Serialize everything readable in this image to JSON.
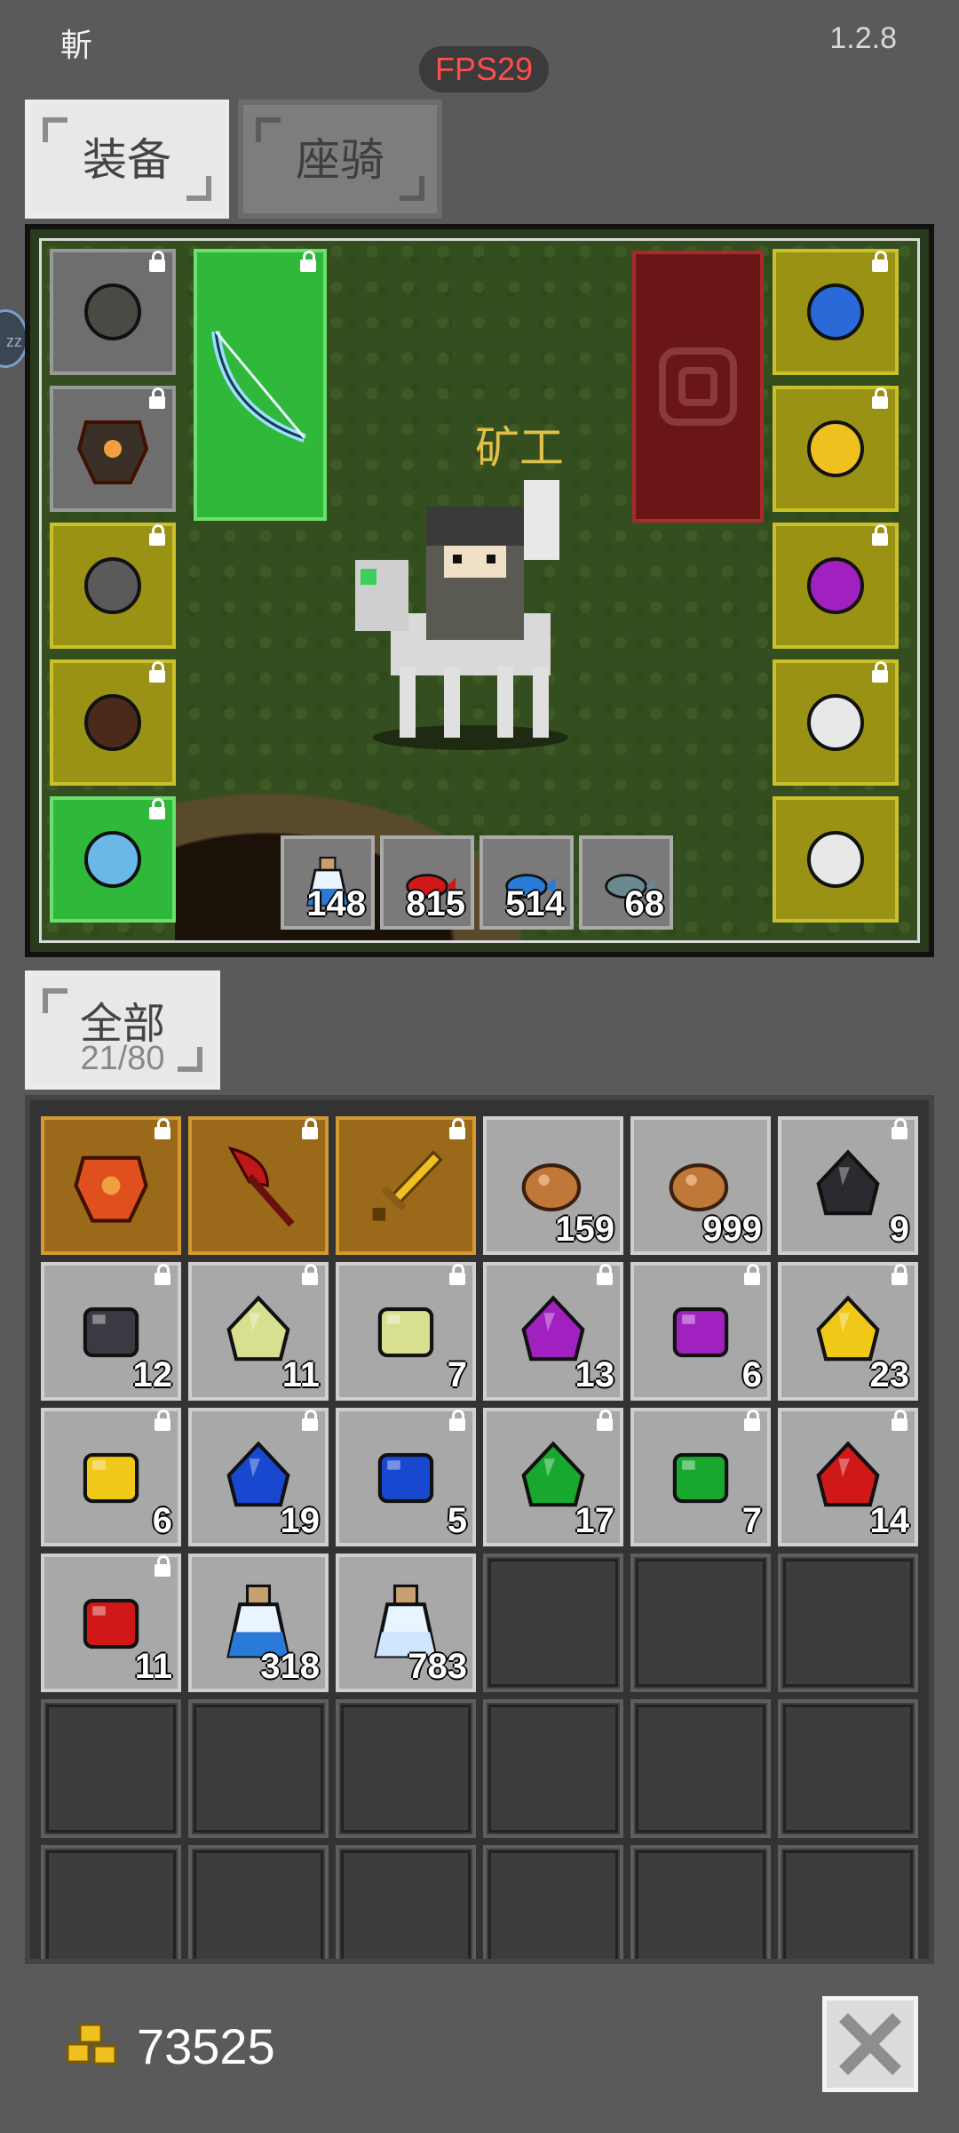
{
  "header": {
    "left_text": "斬",
    "version": "1.2.8",
    "fps": "FPS29"
  },
  "tabs": [
    {
      "label": "装备",
      "active": true
    },
    {
      "label": "座骑",
      "active": false
    }
  ],
  "character": {
    "name": "矿工"
  },
  "side_badge": "zz",
  "equipment": {
    "left_slots": [
      {
        "icon": "horned-helmet-icon",
        "bg": "gray",
        "locked": true
      },
      {
        "icon": "dark-armor-icon",
        "bg": "gray",
        "locked": true
      },
      {
        "icon": "gauntlet-icon",
        "bg": "yellow",
        "locked": true
      },
      {
        "icon": "boots-icon",
        "bg": "yellow",
        "locked": true
      },
      {
        "icon": "belt-icon",
        "bg": "green",
        "locked": true
      }
    ],
    "weapon": {
      "icon": "bow-icon",
      "locked": true
    },
    "offhand": {
      "icon": "empty-offhand-icon"
    },
    "right_slots": [
      {
        "icon": "sapphire-necklace-icon",
        "locked": true
      },
      {
        "icon": "gold-ring-icon",
        "locked": true
      },
      {
        "icon": "amethyst-ring-icon",
        "locked": true
      },
      {
        "icon": "horse-mask-icon",
        "locked": true
      },
      {
        "icon": "skull-mount-icon",
        "locked": false
      }
    ]
  },
  "quickbar": [
    {
      "icon": "blue-potion-icon",
      "count": "148"
    },
    {
      "icon": "red-fish-icon",
      "count": "815"
    },
    {
      "icon": "blue-fish-icon",
      "count": "514"
    },
    {
      "icon": "gray-fish-icon",
      "count": "68"
    }
  ],
  "filter": {
    "label": "全部",
    "count": "21/80"
  },
  "inventory": [
    {
      "icon": "fire-armor-icon",
      "count": "",
      "bg": "gold",
      "locked": true,
      "color": "#e0501e"
    },
    {
      "icon": "red-axe-icon",
      "count": "",
      "bg": "gold",
      "locked": true,
      "color": "#c01818"
    },
    {
      "icon": "golden-sword-icon",
      "count": "",
      "bg": "gold",
      "locked": true,
      "color": "#f0c020"
    },
    {
      "icon": "copper-ore-icon",
      "count": "159",
      "bg": "item",
      "locked": false,
      "color": "#c07838"
    },
    {
      "icon": "copper-ore-icon",
      "count": "999",
      "bg": "item",
      "locked": false,
      "color": "#c07838"
    },
    {
      "icon": "dark-gem-icon",
      "count": "9",
      "bg": "item",
      "locked": true,
      "color": "#2a2a30"
    },
    {
      "icon": "dark-cube-icon",
      "count": "12",
      "bg": "item",
      "locked": true,
      "color": "#3a3a42"
    },
    {
      "icon": "pale-gem-icon",
      "count": "11",
      "bg": "item",
      "locked": true,
      "color": "#d8e090"
    },
    {
      "icon": "pale-cube-icon",
      "count": "7",
      "bg": "item",
      "locked": true,
      "color": "#d8e090"
    },
    {
      "icon": "purple-gem-icon",
      "count": "13",
      "bg": "item",
      "locked": true,
      "color": "#a020c0"
    },
    {
      "icon": "purple-cube-icon",
      "count": "6",
      "bg": "item",
      "locked": true,
      "color": "#a020c0"
    },
    {
      "icon": "yellow-gem-icon",
      "count": "23",
      "bg": "item",
      "locked": true,
      "color": "#f0c818"
    },
    {
      "icon": "yellow-cube-icon",
      "count": "6",
      "bg": "item",
      "locked": true,
      "color": "#f0c818"
    },
    {
      "icon": "blue-gem-icon",
      "count": "19",
      "bg": "item",
      "locked": true,
      "color": "#1848d0"
    },
    {
      "icon": "blue-cube-icon",
      "count": "5",
      "bg": "item",
      "locked": true,
      "color": "#1848d0"
    },
    {
      "icon": "green-gem-icon",
      "count": "17",
      "bg": "item",
      "locked": true,
      "color": "#18a830"
    },
    {
      "icon": "green-cube-icon",
      "count": "7",
      "bg": "item",
      "locked": true,
      "color": "#18a830"
    },
    {
      "icon": "red-gem-icon",
      "count": "14",
      "bg": "item",
      "locked": true,
      "color": "#d01818"
    },
    {
      "icon": "red-cube-icon",
      "count": "11",
      "bg": "item",
      "locked": true,
      "color": "#d01818"
    },
    {
      "icon": "blue-potion-icon",
      "count": "318",
      "bg": "item",
      "locked": false,
      "color": "#2a7ad8"
    },
    {
      "icon": "clear-potion-icon",
      "count": "783",
      "bg": "item",
      "locked": false,
      "color": "#cfe6ff"
    }
  ],
  "empty_slots": 15,
  "gold": {
    "icon": "gold-coins-icon",
    "amount": "73525"
  },
  "close": {
    "icon": "close-icon"
  },
  "colors": {
    "background": "#5a5a5a",
    "fps": "#ff4d4d",
    "name": "#e0c04a"
  }
}
